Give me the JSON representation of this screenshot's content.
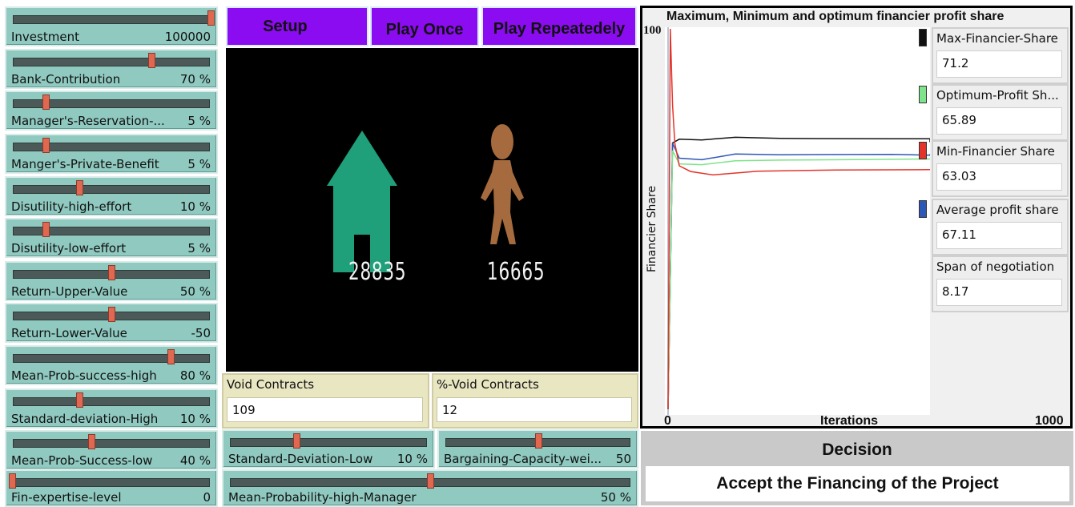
{
  "sliders": [
    {
      "label": "Investment",
      "value": "100000",
      "pos": 1.0
    },
    {
      "label": "Bank-Contribution",
      "value": "70 %",
      "pos": 0.7
    },
    {
      "label": "Manager's-Reservation-...",
      "value": "5 %",
      "pos": 0.17
    },
    {
      "label": "Manger's-Private-Benefit",
      "value": "5 %",
      "pos": 0.17
    },
    {
      "label": "Disutility-high-effort",
      "value": "10 %",
      "pos": 0.34
    },
    {
      "label": "Disutility-low-effort",
      "value": "5 %",
      "pos": 0.17
    },
    {
      "label": "Return-Upper-Value",
      "value": "50 %",
      "pos": 0.5
    },
    {
      "label": "Return-Lower-Value",
      "value": "-50",
      "pos": 0.5
    },
    {
      "label": "Mean-Prob-success-high",
      "value": "80 %",
      "pos": 0.8
    },
    {
      "label": "Standard-deviation-High",
      "value": "10 %",
      "pos": 0.34
    },
    {
      "label": "Mean-Prob-Success-low",
      "value": "40 %",
      "pos": 0.4
    },
    {
      "label": "Fin-expertise-level",
      "value": "0",
      "pos": 0.0
    }
  ],
  "buttons": {
    "setup": "Setup",
    "play_once": "Play Once",
    "play_repeatedly": "Play Repeatedely"
  },
  "world": {
    "house_value": "28835",
    "person_value": "16665",
    "house_color": "#1fa07a",
    "person_color": "#a56a3d"
  },
  "monitors": {
    "void_contracts": {
      "label": "Void Contracts",
      "value": "109"
    },
    "pct_void_contracts": {
      "label": "%-Void Contracts",
      "value": "12"
    }
  },
  "bottom_sliders": [
    {
      "label": "Standard-Deviation-Low",
      "value": "10 %",
      "pos": 0.34
    },
    {
      "label": "Bargaining-Capacity-wei...",
      "value": "50",
      "pos": 0.5
    },
    {
      "label": "Mean-Probability-high-Manager",
      "value": "50 %",
      "pos": 0.5
    }
  ],
  "plot": {
    "title": "Maximum, Minimum and optimum financier profit share",
    "ylabel": "Financier Share",
    "xlabel": "Iterations",
    "y_max_label": "100",
    "x_min_label": "0",
    "x_max_label": "1000"
  },
  "right_monitors": [
    {
      "label": "Max-Financier-Share",
      "value": "71.2",
      "color": "#111111"
    },
    {
      "label": "Optimum-Profit Sh...",
      "value": "65.89",
      "color": "#7ee38a"
    },
    {
      "label": "Min-Financier Share",
      "value": "63.03",
      "color": "#e3342b"
    },
    {
      "label": "Average profit share",
      "value": "67.11",
      "color": "#2f57b5"
    },
    {
      "label": "Span of negotiation",
      "value": "8.17",
      "color": null
    }
  ],
  "decision": {
    "label": "Decision",
    "value": "Accept the Financing of the Project"
  },
  "colors": {
    "slider_bg": "#8fc9c0",
    "button_bg": "#8b0cf0",
    "monitor_bg": "#e9e6c2",
    "world_bg": "#000000"
  },
  "chart_data": {
    "type": "line",
    "title": "Maximum, Minimum and optimum financier profit share",
    "xlabel": "Iterations",
    "ylabel": "Financier Share",
    "xlim": [
      0,
      1000
    ],
    "ylim": [
      0,
      100
    ],
    "series": [
      {
        "color": "#111111",
        "x": [
          0,
          4,
          10,
          30,
          60,
          100,
          200,
          300,
          400,
          410,
          600,
          700,
          800,
          900,
          1000
        ],
        "y": [
          0,
          70,
          71,
          70.8,
          71.5,
          71.2,
          71.1,
          71.1,
          71.2,
          70.2,
          70.4,
          70.8,
          70.8,
          71.2,
          71.2
        ]
      },
      {
        "color": "#2f57b5",
        "x": [
          0,
          4,
          10,
          30,
          60,
          100,
          200,
          300,
          400,
          600,
          800,
          1000
        ],
        "y": [
          0,
          70,
          66,
          65.6,
          67.1,
          66.9,
          67.0,
          66.8,
          67.1,
          67.0,
          67.1,
          67.11
        ]
      },
      {
        "color": "#7ee38a",
        "x": [
          0,
          4,
          10,
          30,
          60,
          100,
          200,
          300,
          500,
          800,
          1000
        ],
        "y": [
          0,
          68,
          64.5,
          64.3,
          65.3,
          65.5,
          65.7,
          65.8,
          65.9,
          65.9,
          65.89
        ]
      },
      {
        "color": "#e3342b",
        "x": [
          0,
          2,
          4,
          6,
          10,
          20,
          40,
          80,
          150,
          300,
          500,
          800,
          1000
        ],
        "y": [
          0,
          100,
          80,
          70,
          64,
          62.5,
          61.6,
          62.6,
          62.9,
          63.0,
          63.0,
          63.0,
          63.03
        ]
      }
    ]
  }
}
